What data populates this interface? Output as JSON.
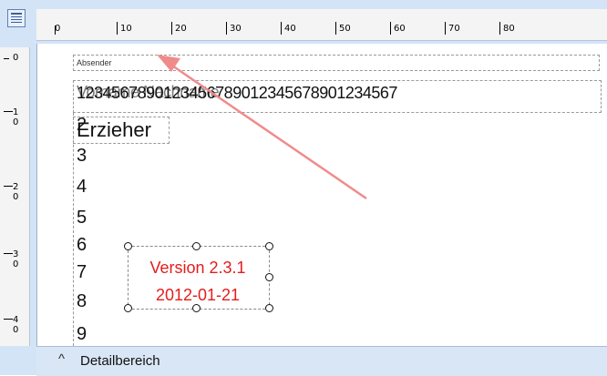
{
  "ruler": {
    "top_labels": [
      "0",
      "10",
      "20",
      "30",
      "40",
      "50",
      "60",
      "70",
      "80"
    ],
    "left_labels": [
      "0",
      "1\n0",
      "2\n0",
      "3\n0",
      "4\n0"
    ]
  },
  "fields": {
    "sender_label": "Absender",
    "long_text": "1234567890123456789012345678901234567",
    "long_text_overlap": "Vorname Nachname",
    "erzieher": "Erzieher",
    "numbers": [
      "2",
      "3",
      "4",
      "5",
      "6",
      "7",
      "8",
      "9"
    ],
    "version_line1": "Version 2.3.1",
    "version_line2": "2012-01-21"
  },
  "status": {
    "caret": "^",
    "section_label": "Detailbereich"
  },
  "colors": {
    "annotation_arrow": "#f08b8b",
    "version_text": "#e31d1d",
    "ruler_bg": "#f4f4f4",
    "frame_bg": "#d4e4f7"
  },
  "icons": {
    "corner": "table-icon",
    "arrow": "annotation-arrow"
  }
}
